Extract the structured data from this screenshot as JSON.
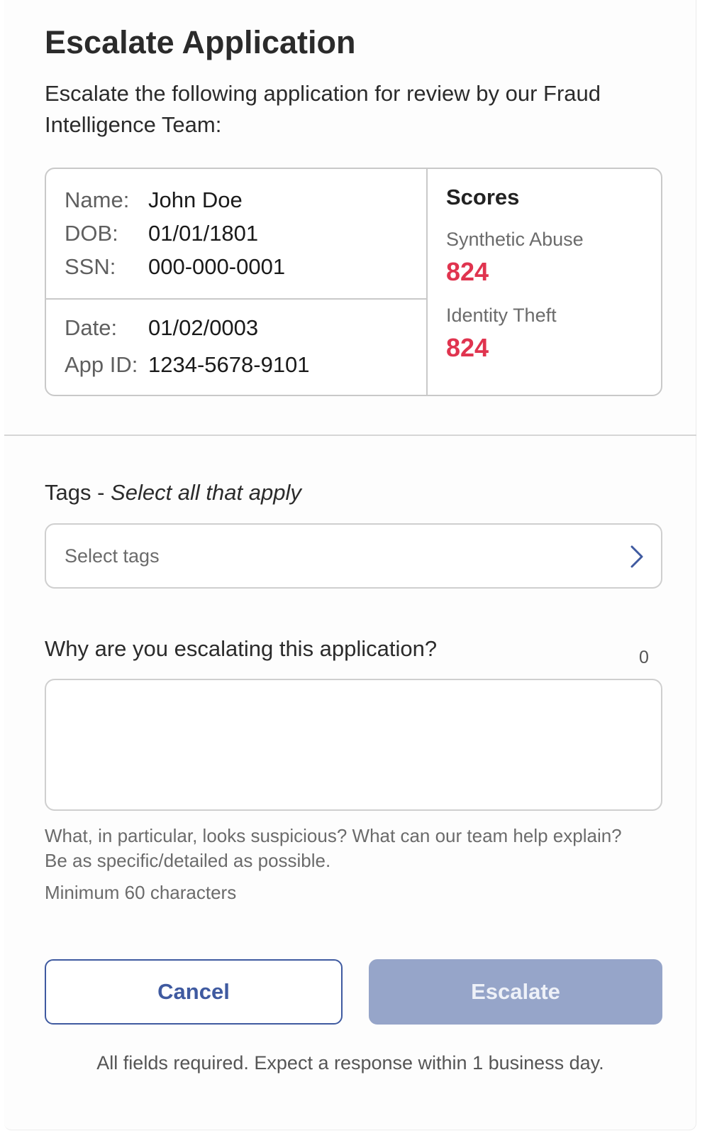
{
  "header": {
    "title": "Escalate Application",
    "intro": "Escalate the following application for review by our Fraud Intelligence Team:"
  },
  "applicant": {
    "name_label": "Name:",
    "name": "John Doe",
    "dob_label": "DOB:",
    "dob": "01/01/1801",
    "ssn_label": "SSN:",
    "ssn": "000-000-0001",
    "date_label": "Date:",
    "date": "01/02/0003",
    "app_id_label": "App ID:",
    "app_id": "1234-5678-9101"
  },
  "scores": {
    "title": "Scores",
    "items": [
      {
        "label": "Synthetic Abuse",
        "value": "824"
      },
      {
        "label": "Identity Theft",
        "value": "824"
      }
    ],
    "value_color": "#e0344f"
  },
  "tags": {
    "label": "Tags - ",
    "label_hint": "Select all that apply",
    "placeholder": "Select tags",
    "icon": "chevron-right-icon"
  },
  "reason": {
    "label": "Why are you escalating this application?",
    "char_count": "0",
    "value": "",
    "hint": "What, in particular, looks suspicious? What can our team help explain? Be as specific/detailed as possible.",
    "min_chars": "Minimum 60 characters"
  },
  "actions": {
    "cancel_label": "Cancel",
    "escalate_label": "Escalate",
    "primary_color": "#3f5aa0",
    "disabled_color": "#96a5c9"
  },
  "footer": {
    "note": "All fields required. Expect a response within 1 business day."
  }
}
